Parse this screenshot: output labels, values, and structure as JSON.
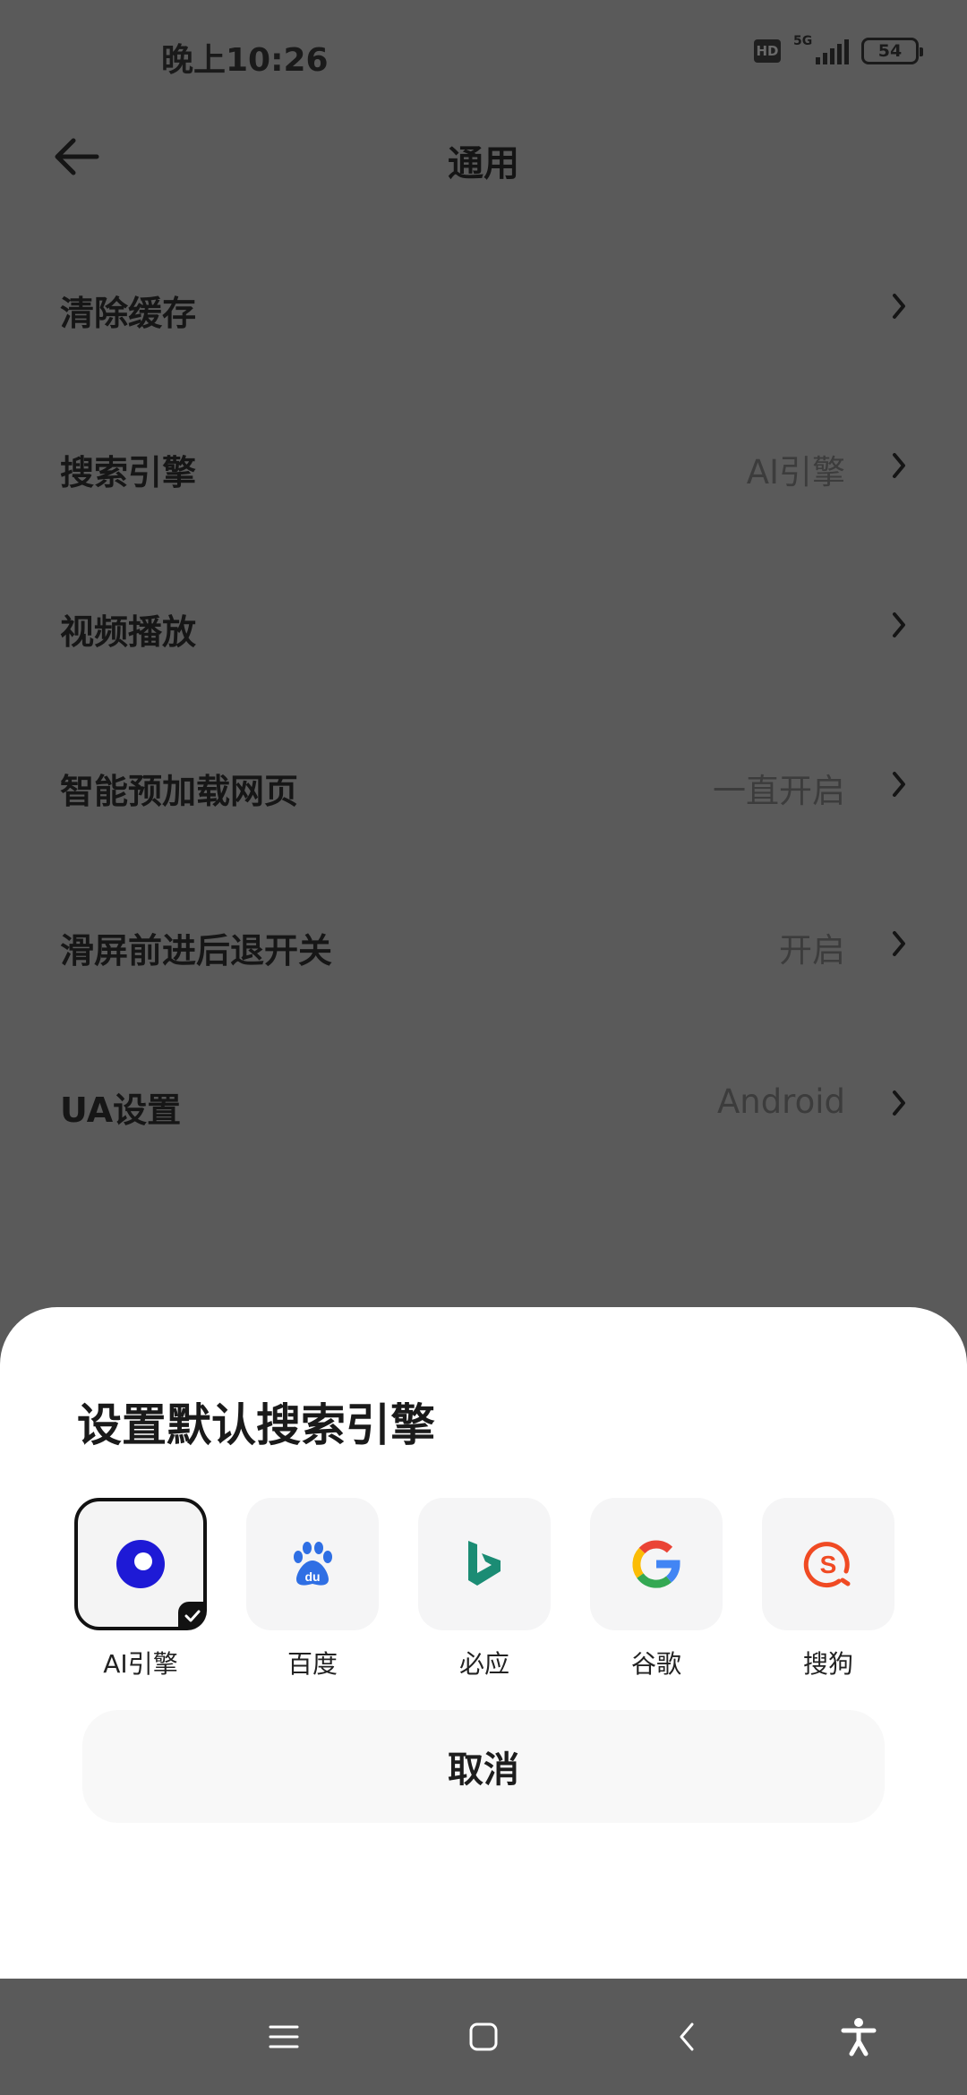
{
  "status_bar": {
    "time": "晚上10:26",
    "hd": "HD",
    "network": "5G",
    "battery": "54"
  },
  "header": {
    "title": "通用",
    "back_icon": "arrow-left-icon"
  },
  "settings": [
    {
      "label": "清除缓存",
      "value": ""
    },
    {
      "label": "搜索引擎",
      "value": "AI引擎"
    },
    {
      "label": "视频播放",
      "value": ""
    },
    {
      "label": "智能预加载网页",
      "value": "一直开启"
    },
    {
      "label": "滑屏前进后退开关",
      "value": "开启"
    },
    {
      "label": "UA设置",
      "value": "Android"
    }
  ],
  "sheet": {
    "title": "设置默认搜索引擎",
    "engines": [
      {
        "name": "AI引擎",
        "icon": "ai-engine-icon",
        "selected": true
      },
      {
        "name": "百度",
        "icon": "baidu-icon",
        "selected": false
      },
      {
        "name": "必应",
        "icon": "bing-icon",
        "selected": false
      },
      {
        "name": "谷歌",
        "icon": "google-icon",
        "selected": false
      },
      {
        "name": "搜狗",
        "icon": "sogou-icon",
        "selected": false
      }
    ],
    "cancel_label": "取消"
  },
  "nav_bar": {
    "buttons": [
      "menu-icon",
      "home-icon",
      "back-icon",
      "accessibility-icon"
    ]
  },
  "colors": {
    "scrim_bg": "#5a5a5a",
    "sheet_bg": "#ffffff",
    "ai_engine": "#1e1ad6",
    "baidu": "#2f6fe4",
    "bing": "#1b8c74",
    "sogou": "#f04a23"
  }
}
